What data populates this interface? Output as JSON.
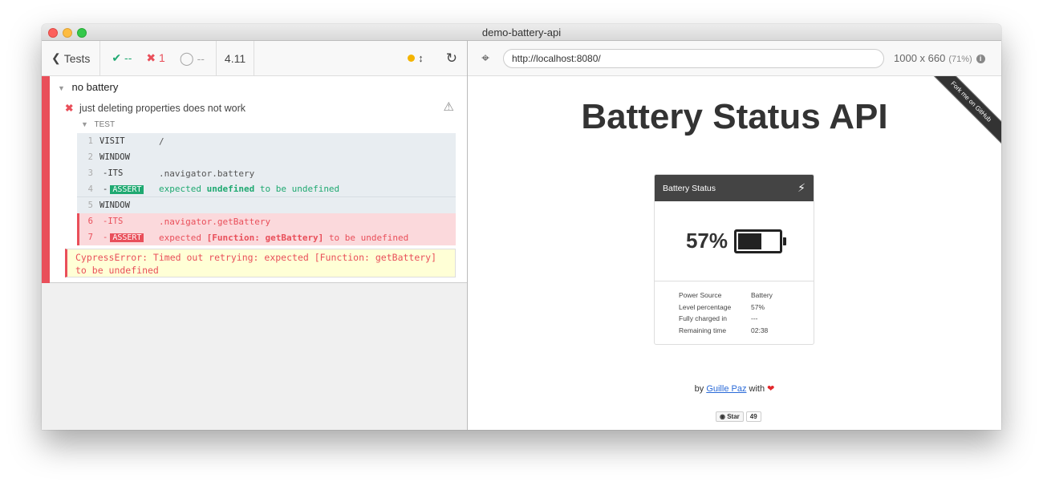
{
  "window": {
    "title": "demo-battery-api"
  },
  "runner": {
    "tests_label": "Tests",
    "passed": "--",
    "failed": "1",
    "pending": "--",
    "duration": "4.11",
    "suite_title": "no battery",
    "test_title": "just deleting properties does not work",
    "test_section_label": "TEST",
    "commands": [
      {
        "num": "1",
        "name": "VISIT",
        "message": "/",
        "state": "passed"
      },
      {
        "num": "2",
        "name": "WINDOW",
        "message": "",
        "state": "passed"
      },
      {
        "num": "3",
        "name": "-ITS",
        "message": ".navigator.battery",
        "state": "passed"
      },
      {
        "num": "4",
        "name": "ASSERT",
        "prefix": "-",
        "msg_pre": "expected",
        "msg_val": "undefined",
        "msg_post": "to be undefined",
        "state": "passed"
      },
      {
        "num": "5",
        "name": "WINDOW",
        "message": "",
        "state": "passed"
      },
      {
        "num": "6",
        "name": "-ITS",
        "message": ".navigator.getBattery",
        "state": "failed"
      },
      {
        "num": "7",
        "name": "ASSERT",
        "prefix": "-",
        "msg_pre": "expected",
        "msg_val": "[Function: getBattery]",
        "msg_post": "to be undefined",
        "state": "failed"
      }
    ],
    "error": "CypressError: Timed out retrying: expected [Function: getBattery] to be undefined"
  },
  "aut": {
    "url": "http://localhost:8080/",
    "viewport": "1000 x 660",
    "scale": "(71%)"
  },
  "app": {
    "ribbon": "Fork me on GitHub",
    "title": "Battery Status API",
    "card_title": "Battery Status",
    "percentage": "57%",
    "level_fraction": 0.57,
    "details": [
      {
        "label": "Power Source",
        "value": "Battery"
      },
      {
        "label": "Level percentage",
        "value": "57%"
      },
      {
        "label": "Fully charged in",
        "value": "---"
      },
      {
        "label": "Remaining time",
        "value": "02:38"
      }
    ],
    "byline_pre": "by",
    "author": "Guille Paz",
    "byline_post": "with",
    "star_label": "Star",
    "star_count": "49"
  },
  "colors": {
    "pass": "#1fa971",
    "fail": "#e94f5a",
    "pending": "#a6a6a6"
  }
}
